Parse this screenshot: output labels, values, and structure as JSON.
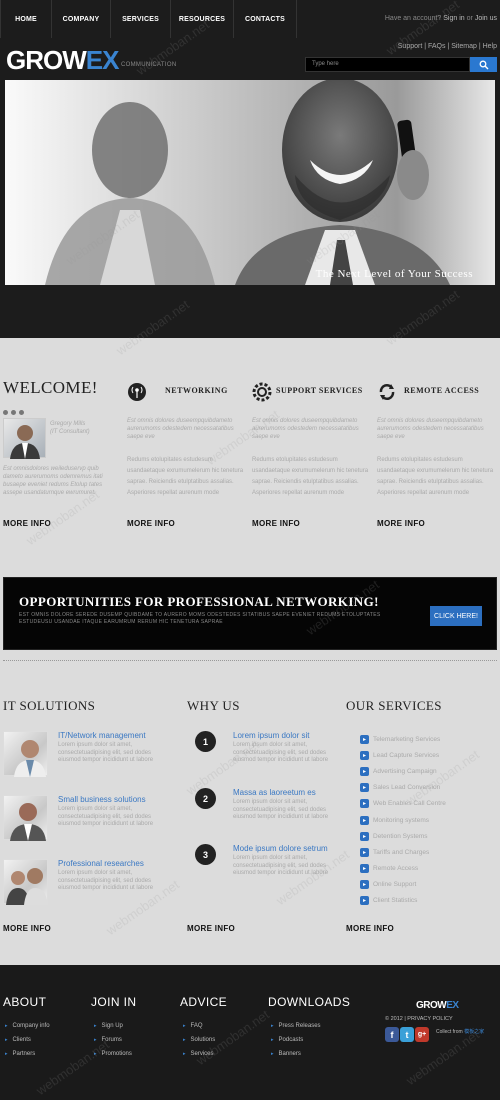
{
  "nav": {
    "items": [
      "HOME",
      "COMPANY",
      "SERVICES",
      "RESOURCES",
      "CONTACTS"
    ]
  },
  "header": {
    "account_text": "Have an account?",
    "signin": "Sign in",
    "or": "or",
    "join": "Join us",
    "links": "Support | FAQs | Sitemap | Help",
    "logo_a": "GROW",
    "logo_b": "EX",
    "tagline": "COMMUNICATION",
    "search_placeholder": "Type here",
    "hero_caption": "The Next Level of Your Success"
  },
  "welcome": {
    "title": "WELCOME!",
    "person_name": "Gregory Mills",
    "person_role": "(IT Consultant)",
    "quote": "Est omnisdolores weileduservp quib dameto aurerumoms odemremus itati busaepe eveniet redums Etolup tates assepe usandaturnque ewrumuret.",
    "more": "MORE INFO"
  },
  "features": [
    {
      "title": "NETWORKING",
      "intro": "Est omnis dolores duseempquibdameto aurerumoms odestedem necessatatibus saepe eve",
      "body": "Redums etolupitates estudesum usandaetaque exrumumelerum hic tenetura saprae. Reiciendis etulptatibus assalias. Asperiores repellat aurenum mode",
      "more": "MORE INFO"
    },
    {
      "title": "SUPPORT SERVICES",
      "intro": "Est omnis dolores duseempquibdameto aurerumoms odestedem necessatatibus saepe eve",
      "body": "Redums etolupitates estudesum usandaetaque exrumumelerum hic tenetura saprae. Reiciendis etulptatibus assalias. Asperiores repellat aurenum mode",
      "more": "MORE INFO"
    },
    {
      "title": "REMOTE ACCESS",
      "intro": "Est omnis dolores duseempquibdameto aurerumoms odestedem necessatatibus saepe eve",
      "body": "Redums etolupitates estudesum usandaetaque exrumumelerum hic tenetura saprae. Reiciendis etulptatibus assalias. Asperiores repellat aurenum mode",
      "more": "MORE INFO"
    }
  ],
  "banner": {
    "title": "OPPORTUNITIES FOR PROFESSIONAL NETWORKING!",
    "text": "EST OMNIS DOLORE SEREDE DUSEMP QUIBDAME TO AURERO MOMS ODESTEDES SITATIBUS SAEPE EVENIET REDUMS ETOLUPTATES ESTUDEUSU USANDAE ITAQUE EARUMRUM RERUM HIC TENETURA SAPRAE",
    "button": "CLICK HERE!"
  },
  "solutions": {
    "title": "IT SOLUTIONS",
    "items": [
      {
        "title": "IT/Network management",
        "text": "Lorem ipsum dolor sit amet, consectetuadipising elit, sed dodes eiusmod tempor incididunt ut labore"
      },
      {
        "title": "Small business solutions",
        "text": "Lorem ipsum dolor sit amet, consectetuadipising elit, sed dodes eiusmod tempor incididunt ut labore"
      },
      {
        "title": "Professional researches",
        "text": "Lorem ipsum dolor sit amet, consectetuadipising elit, sed dodes eiusmod tempor incididunt ut labore"
      }
    ],
    "more": "MORE INFO"
  },
  "why": {
    "title": "WHY US",
    "items": [
      {
        "num": "1",
        "title": "Lorem ipsum dolor sit",
        "text": "Lorem ipsum dolor sit amet, consectetuadipising elit, sed dodes eiusmod tempor incididunt ut labore"
      },
      {
        "num": "2",
        "title": "Massa as laoreetum es",
        "text": "Lorem ipsum dolor sit amet, consectetuadipising elit, sed dodes eiusmod tempor incididunt ut labore"
      },
      {
        "num": "3",
        "title": "Mode ipsum dolore setrum",
        "text": "Lorem ipsum dolor sit amet, consectetuadipising elit, sed dodes eiusmod tempor incididunt ut labore"
      }
    ],
    "more": "MORE INFO"
  },
  "services": {
    "title": "OUR SERVICES",
    "items": [
      "Telemarketing Services",
      "Lead Capture Services",
      "Advertising Campaign",
      "Sales Lead Conversion",
      "Web Enables Call Centre",
      "Monitoring systems",
      "Detention Systems",
      "Tariffs and Charges",
      "Remote Access",
      "Online Support",
      "Client Statistics"
    ],
    "more": "MORE INFO"
  },
  "footer": {
    "cols": [
      {
        "title": "ABOUT",
        "links": [
          "Company info",
          "Clients",
          "Partners"
        ]
      },
      {
        "title": "JOIN IN",
        "links": [
          "Sign Up",
          "Forums",
          "Promotions"
        ]
      },
      {
        "title": "ADVICE",
        "links": [
          "FAQ",
          "Solutions",
          "Services"
        ]
      },
      {
        "title": "DOWNLOADS",
        "links": [
          "Press Releases",
          "Podcasts",
          "Banners"
        ]
      }
    ],
    "logo_a": "GROW",
    "logo_b": "EX",
    "copyright": "© 2012 | PRIVACY POLICY",
    "collect": "Collect from",
    "collect_site": "模板之家",
    "social": [
      "f",
      "t",
      "g+"
    ]
  },
  "watermark": "webmoban.net",
  "colors": {
    "accent": "#2c6fc0",
    "dark": "#1c1c1c",
    "bg": "#dcdcdc",
    "link": "#3a78c3"
  }
}
